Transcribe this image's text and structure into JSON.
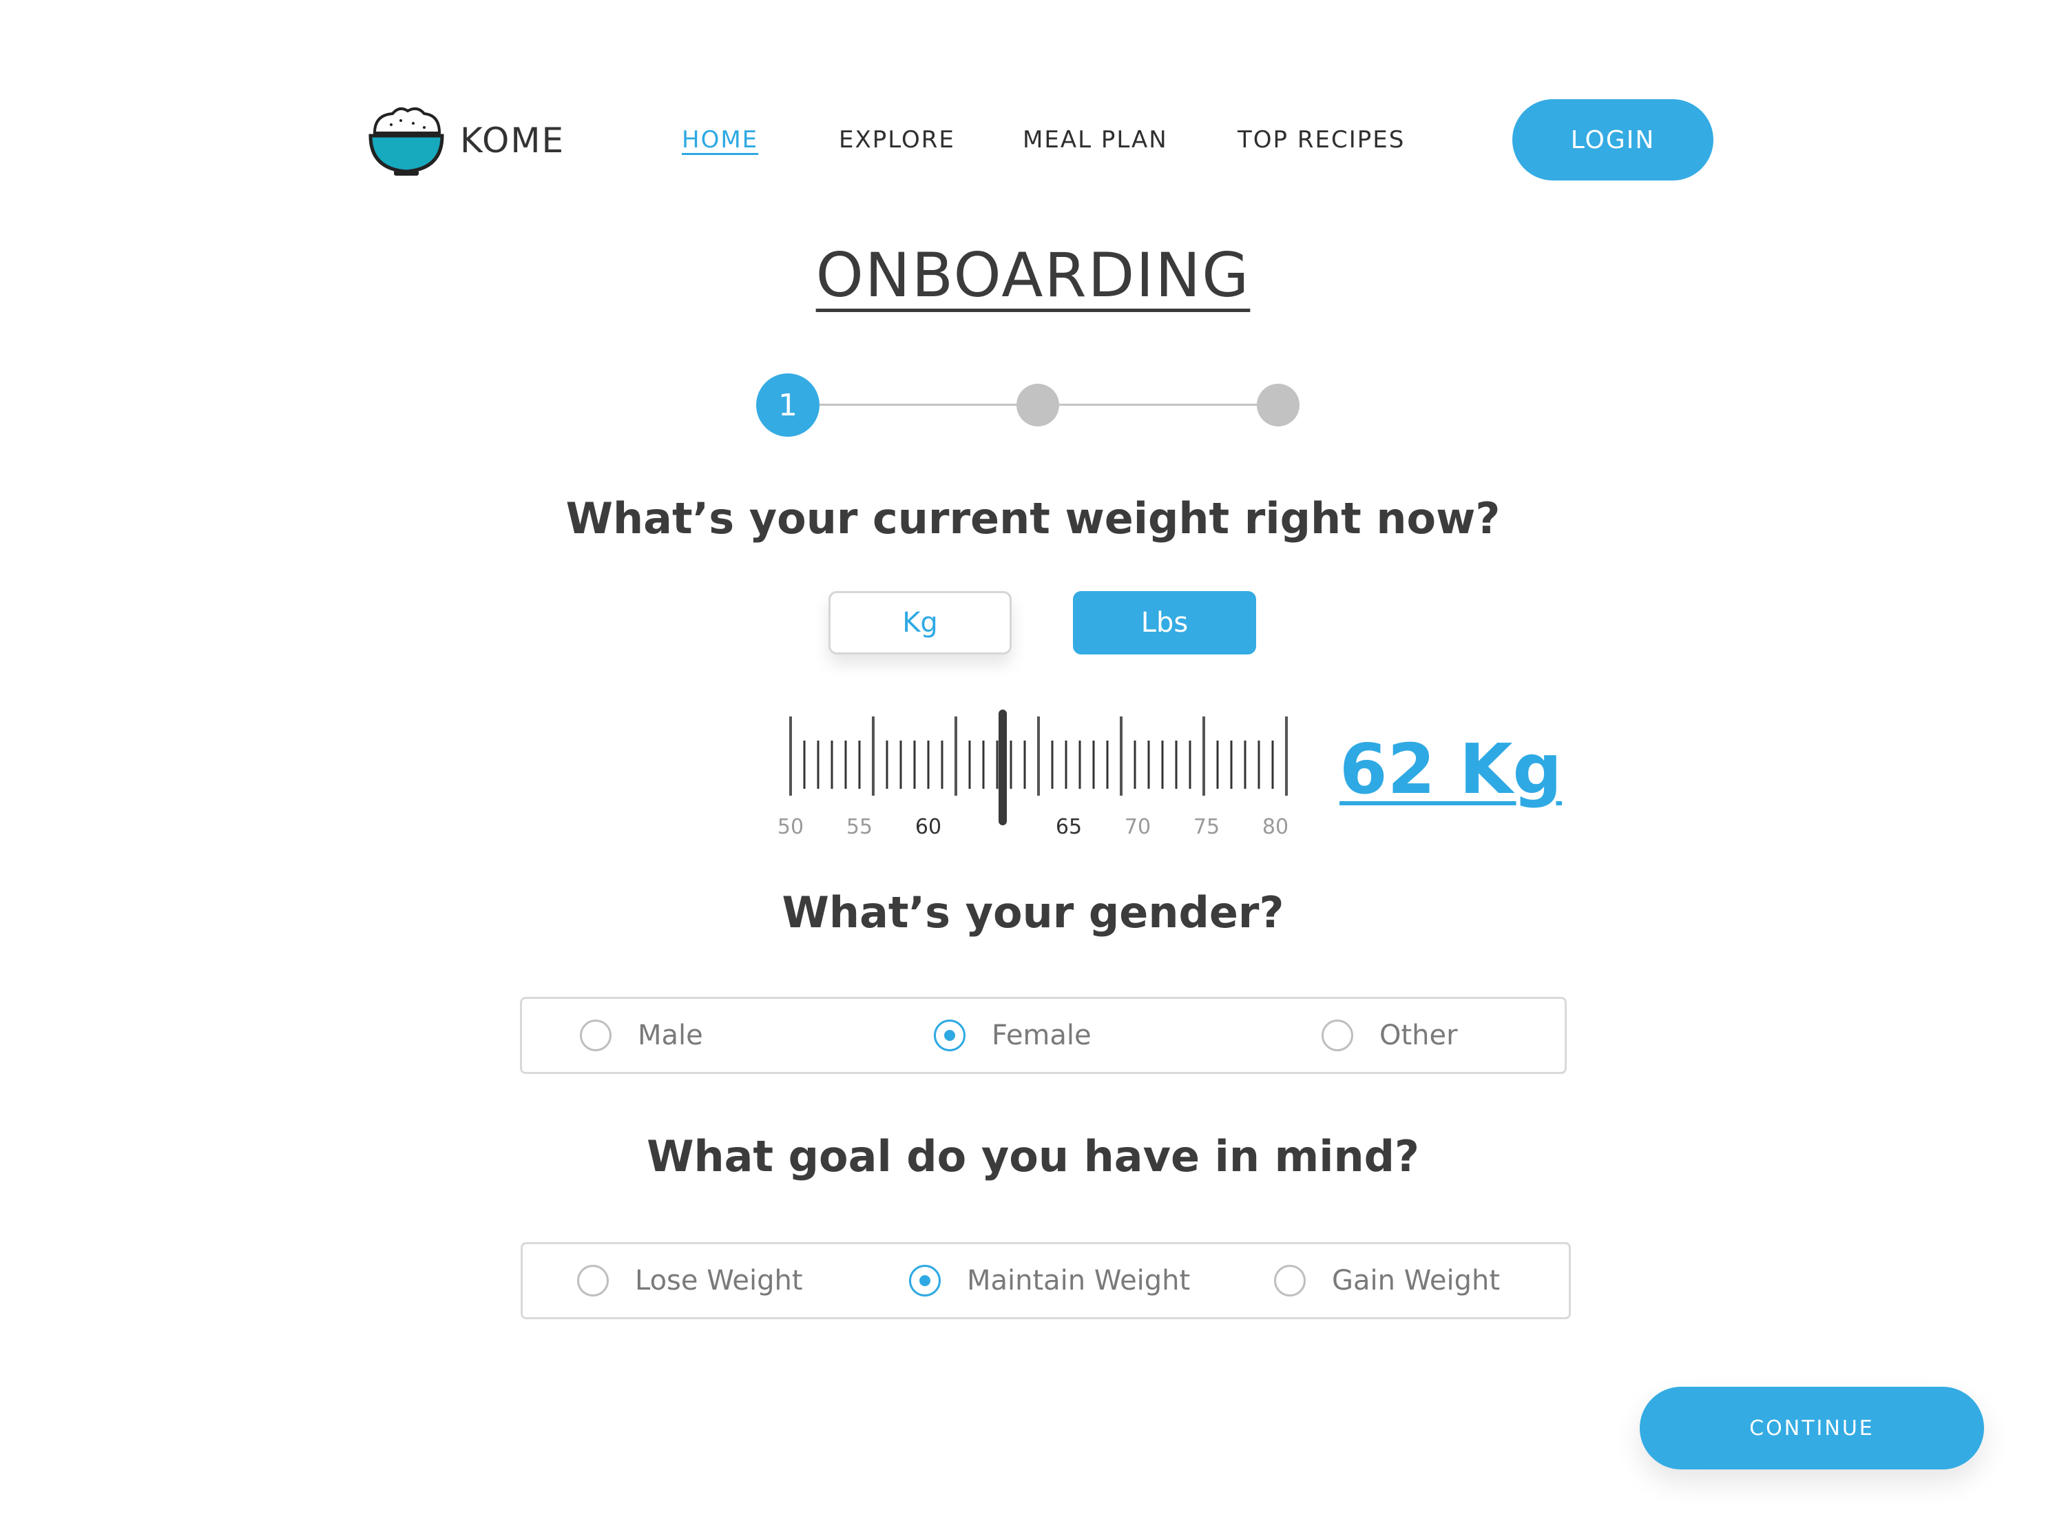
{
  "brand": {
    "name": "KOME"
  },
  "nav": {
    "items": [
      {
        "label": "HOME",
        "active": true
      },
      {
        "label": "EXPLORE",
        "active": false
      },
      {
        "label": "MEAL PLAN",
        "active": false
      },
      {
        "label": "TOP RECIPES",
        "active": false
      }
    ],
    "login_label": "LOGIN"
  },
  "page": {
    "title": "ONBOARDING"
  },
  "stepper": {
    "current_step": 1,
    "current_label": "1",
    "total_steps": 3
  },
  "weight": {
    "question": "What’s your current weight right now?",
    "units": [
      {
        "label": "Kg"
      },
      {
        "label": "Lbs"
      }
    ],
    "ruler_labels": [
      "50",
      "55",
      "60",
      "65",
      "70",
      "75",
      "80"
    ],
    "ruler_min": 50,
    "ruler_max": 80,
    "selected": 62,
    "display": "62 Kg"
  },
  "gender": {
    "question": "What’s your gender?",
    "options": [
      {
        "label": "Male",
        "checked": false
      },
      {
        "label": "Female",
        "checked": true
      },
      {
        "label": "Other",
        "checked": false
      }
    ]
  },
  "goal": {
    "question": "What goal do you have in mind?",
    "options": [
      {
        "label": "Lose Weight",
        "checked": false
      },
      {
        "label": "Maintain Weight",
        "checked": true
      },
      {
        "label": "Gain Weight",
        "checked": false
      }
    ]
  },
  "continue_label": "CONTINUE",
  "colors": {
    "accent": "#34abe3",
    "text": "#3c3c3c",
    "muted": "#7a7a7a",
    "inactive_step": "#c2c2c2"
  }
}
